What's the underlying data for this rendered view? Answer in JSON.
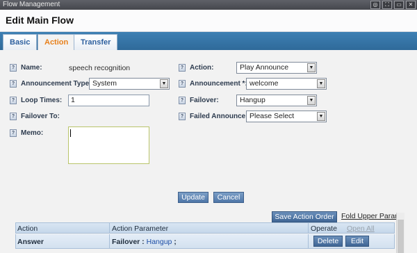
{
  "window": {
    "title": "Flow Management",
    "controls": [
      "settings-icon",
      "fullscreen-icon",
      "restore-icon",
      "close-icon"
    ]
  },
  "page": {
    "title": "Edit Main Flow"
  },
  "tabs": [
    {
      "label": "Basic",
      "active": false
    },
    {
      "label": "Action",
      "active": true
    },
    {
      "label": "Transfer",
      "active": false
    }
  ],
  "form": {
    "name": {
      "label": "Name:",
      "value": "speech recognition"
    },
    "action": {
      "label": "Action:",
      "value": "Play Announce"
    },
    "announcement_type": {
      "label": "Announcement Type:",
      "value": "System"
    },
    "announcement": {
      "label": "Announcement *:",
      "value": "welcome"
    },
    "loop_times": {
      "label": "Loop Times:",
      "value": "1"
    },
    "failover": {
      "label": "Failover:",
      "value": "Hangup"
    },
    "failover_to": {
      "label": "Failover To:"
    },
    "failed_announce": {
      "label": "Failed Announce:",
      "value": "Please Select"
    },
    "memo": {
      "label": "Memo:",
      "value": ""
    },
    "help_glyph": "?",
    "dropdown_glyph": "▼"
  },
  "buttons": {
    "update": "Update",
    "cancel": "Cancel",
    "save_action_order": "Save Action Order",
    "fold_upper_param": "Fold Upper Param"
  },
  "table": {
    "headers": {
      "action": "Action",
      "param": "Action Parameter",
      "operate": "Operate",
      "open_all": "Open All"
    },
    "rows": [
      {
        "action": "Answer",
        "param_key": "Failover : ",
        "param_value": "Hangup",
        "param_suffix": " ;",
        "delete": "Delete",
        "edit": "Edit"
      }
    ]
  },
  "colors": {
    "tabbar": "#2f6a9a",
    "active_tab_text": "#e8801a",
    "button": "#4f77a8",
    "link": "#1d4ea6"
  }
}
